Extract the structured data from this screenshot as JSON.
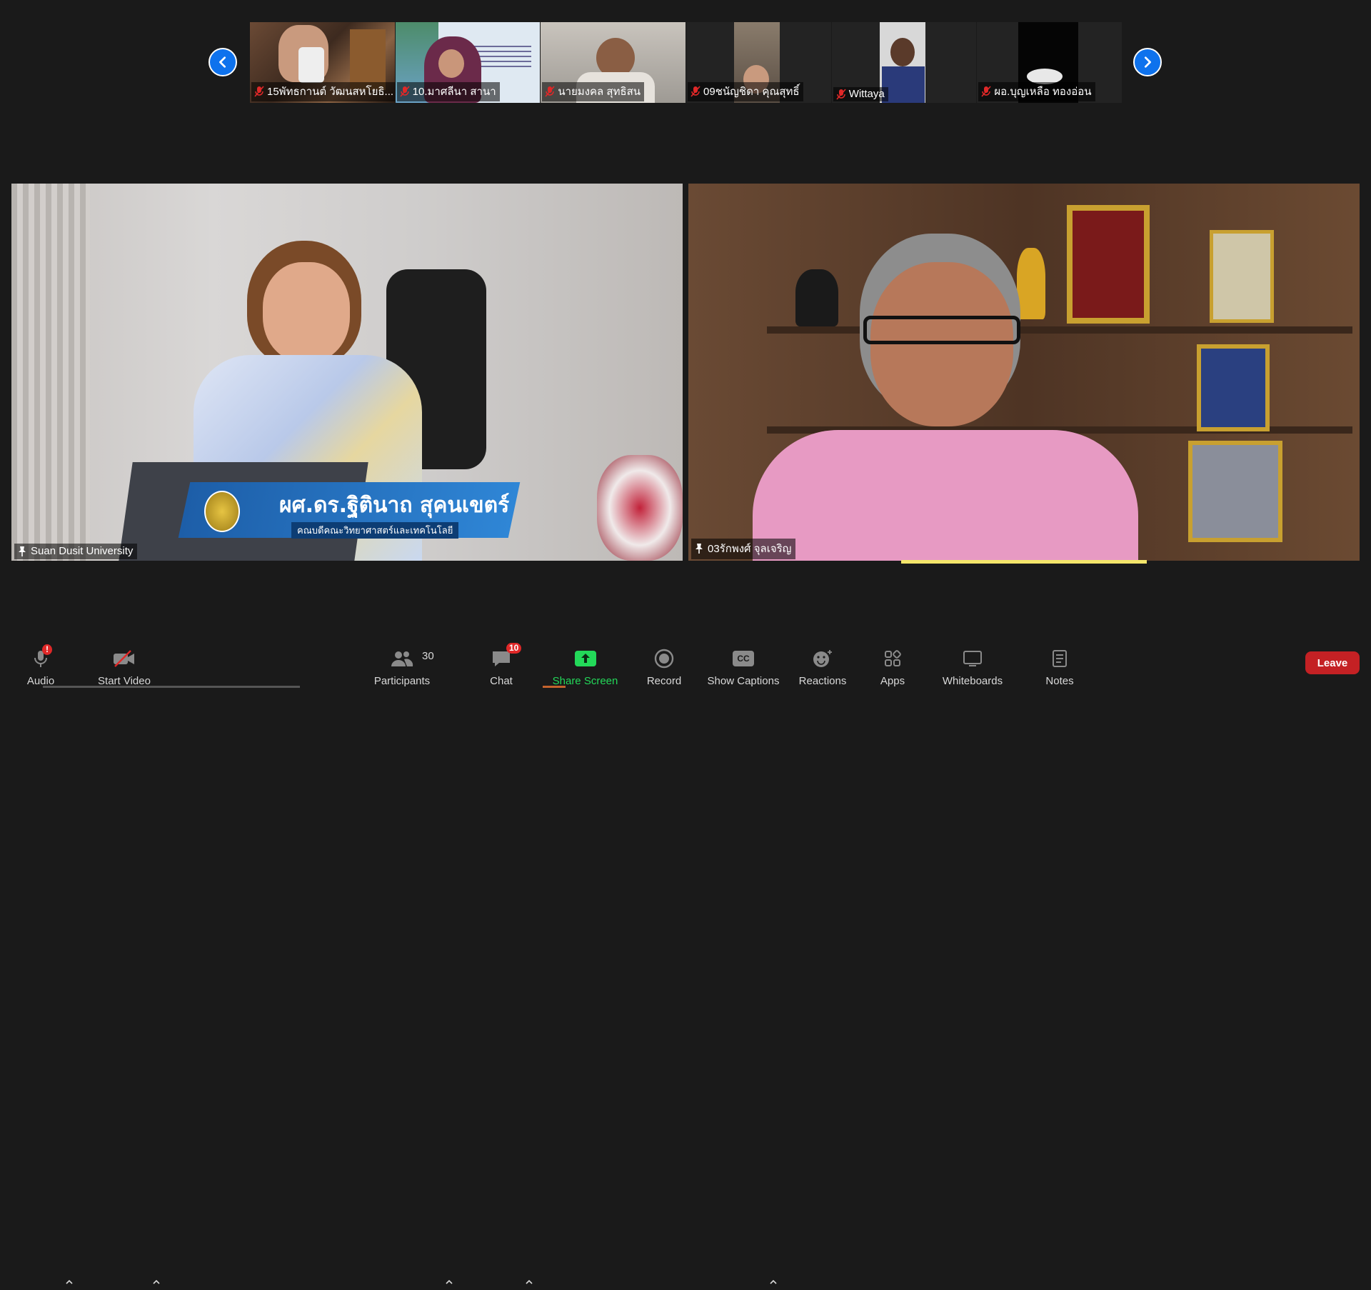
{
  "thumbnails": [
    {
      "name": "15พัทธกานต์  วัฒนสหโยธิ..."
    },
    {
      "name": "10.มาศลีนา  สานา"
    },
    {
      "name": "นายมงคล สุทธิสน"
    },
    {
      "name": "09ชนัญชิดา  คุณสุทธิ์"
    },
    {
      "name": "Wittaya"
    },
    {
      "name": "ผอ.บุญเหลือ ทองอ่อน"
    }
  ],
  "main_tiles": {
    "left": {
      "participant": "Suan Dusit University",
      "banner_name": "ผศ.ดร.ฐิตินาถ สุคนเขตร์",
      "banner_title": "คณบดีคณะวิทยาศาสตร์และเทคโนโลยี"
    },
    "right": {
      "participant": "03รักพงศ์ จุลเจริญ"
    }
  },
  "toolbar": {
    "audio_label": "Audio",
    "start_video_label": "Start Video",
    "participants_label": "Participants",
    "participants_count": "30",
    "chat_label": "Chat",
    "chat_badge": "10",
    "share_screen_label": "Share Screen",
    "record_label": "Record",
    "show_captions_label": "Show Captions",
    "captions_icon_text": "CC",
    "reactions_label": "Reactions",
    "apps_label": "Apps",
    "whiteboards_label": "Whiteboards",
    "notes_label": "Notes",
    "leave_label": "Leave",
    "audio_alert": "!"
  },
  "colors": {
    "accent": "#0e72ed",
    "leave": "#c42124",
    "share": "#23d959",
    "active_speaker": "#f4e66b"
  }
}
